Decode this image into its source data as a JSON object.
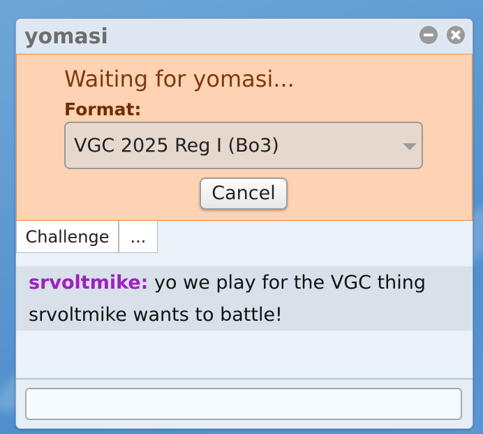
{
  "window": {
    "title": "yomasi"
  },
  "challenge": {
    "status_text": "Waiting for yomasi...",
    "format_label": "Format:",
    "format_value": "VGC 2025 Reg I (Bo3)",
    "cancel_label": "Cancel"
  },
  "tabs": [
    {
      "label": "Challenge"
    },
    {
      "label": "..."
    }
  ],
  "messages": [
    {
      "user": "srvoltmike:",
      "text": "yo we play for the VGC thing"
    }
  ],
  "notice": "srvoltmike wants to battle!",
  "chat_input": {
    "value": "",
    "placeholder": ""
  },
  "colors": {
    "challenge_panel_bg": "#fed3b3",
    "challenge_panel_border": "#ee8a44",
    "username": "#a020c0",
    "status_text": "#7b3a10"
  },
  "icons": {
    "minimize": "minimize-icon",
    "close": "close-icon",
    "dropdown": "chevron-down-icon"
  }
}
